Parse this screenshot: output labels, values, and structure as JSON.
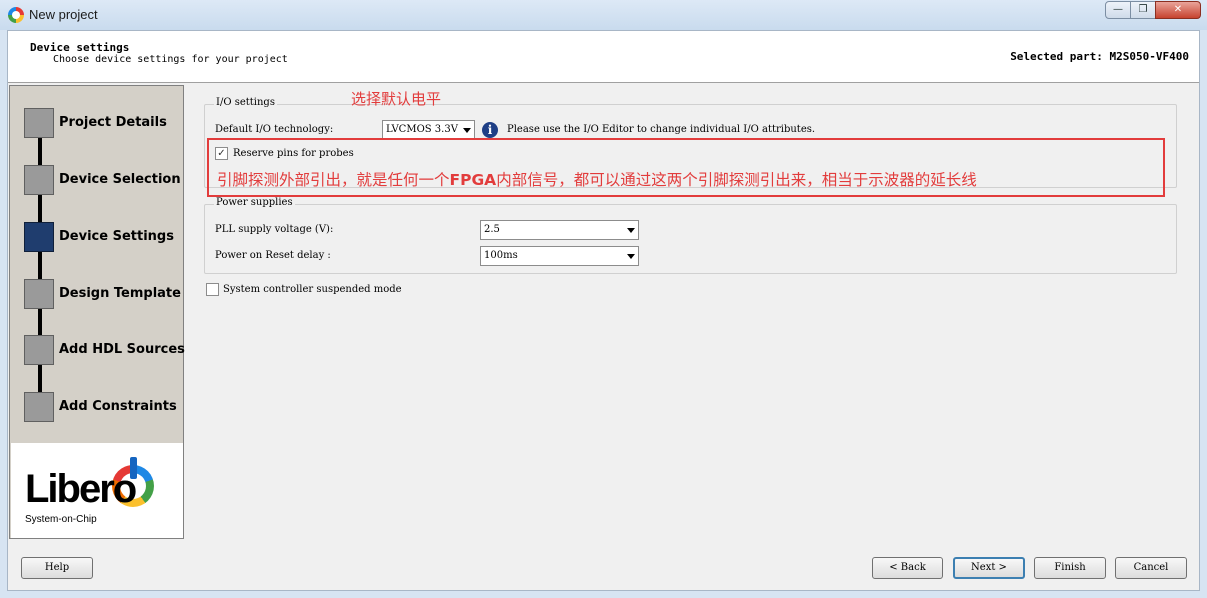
{
  "window": {
    "title": "New project",
    "minimize_glyph": "—",
    "restore_glyph": "❐",
    "close_glyph": "✕"
  },
  "header": {
    "title": "Device settings",
    "subtitle": "Choose device settings for your project",
    "selected_part": "Selected part: M2S050-VF400"
  },
  "steps": [
    {
      "label": "Project Details"
    },
    {
      "label": "Device Selection"
    },
    {
      "label": "Device Settings",
      "active": true
    },
    {
      "label": "Design Template"
    },
    {
      "label": "Add HDL Sources"
    },
    {
      "label": "Add Constraints"
    }
  ],
  "logo": {
    "brand": "Libero",
    "tagline": "System-on-Chip"
  },
  "io_settings": {
    "group_label": "I/O settings",
    "tech_label": "Default I/O technology:",
    "tech_value": "LVCMOS 3.3V",
    "info_glyph": "i",
    "info_text": "Please use the I/O Editor to change individual I/O attributes.",
    "probes_label": "Reserve pins for probes",
    "probes_checked": true
  },
  "power_supplies": {
    "group_label": "Power supplies",
    "pll_label": "PLL supply voltage (V):",
    "pll_value": "2.5",
    "reset_label": "Power on Reset delay :",
    "reset_value": "100ms"
  },
  "system_controller": {
    "label": "System controller suspended mode",
    "checked": false
  },
  "annotations": {
    "default_level": "选择默认电平",
    "probe_note_1": "引脚探测外部引出，就是任何一个",
    "probe_note_fpga": "FPGA",
    "probe_note_2": "内部信号，都可以通过这两个引脚探测引出来，相当于示波器的延长线",
    "color": "#e23c3c"
  },
  "buttons": {
    "help": "Help",
    "back": "< Back",
    "next": "Next >",
    "finish": "Finish",
    "cancel": "Cancel"
  },
  "check_glyph": "✓"
}
